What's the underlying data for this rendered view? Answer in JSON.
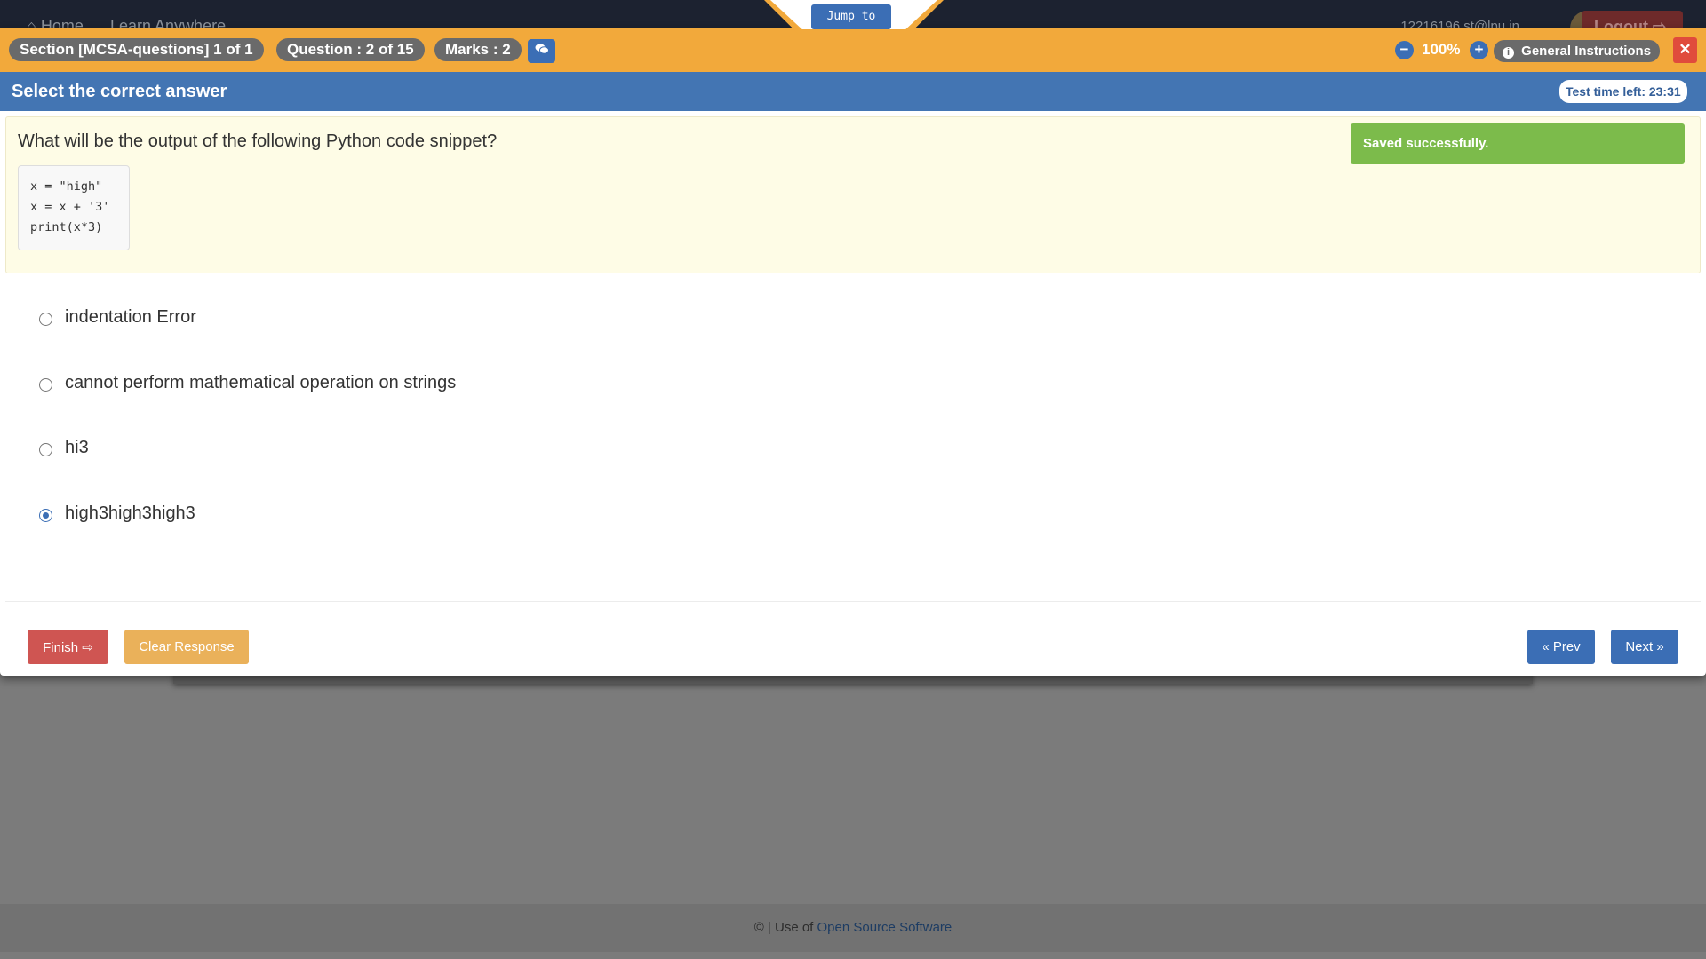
{
  "topnav": {
    "home_label": "Home",
    "learn_label": "Learn Anywhere",
    "user_id": "12216196.st@lpu.in",
    "logout_label": "Logout"
  },
  "header": {
    "section_label": "Section [MCSA-questions] 1 of 1",
    "question_label": "Question : 2 of 15",
    "marks_label": "Marks : 2",
    "zoom_level": "100%",
    "zoom_out_symbol": "−",
    "zoom_in_symbol": "+",
    "instructions_label": "General Instructions",
    "close_symbol": "✕",
    "jump_label": "Jump to"
  },
  "subheader": {
    "title": "Select the correct answer",
    "timer_label": "Test time left: 23:31"
  },
  "question": {
    "text": "What will be the output of the following Python code snippet?",
    "code_lines": [
      "x = \"high\"",
      "x = x + '3'",
      "print(x*3)"
    ]
  },
  "notification": {
    "text": "Saved successfully."
  },
  "options": [
    {
      "label": "indentation Error",
      "selected": false
    },
    {
      "label": "cannot perform mathematical operation on strings",
      "selected": false
    },
    {
      "label": "hi3",
      "selected": false
    },
    {
      "label": "high3high3high3",
      "selected": true
    }
  ],
  "actions": {
    "finish_label": "Finish",
    "clear_label": "Clear Response",
    "prev_label": "« Prev",
    "next_label": "Next »"
  },
  "footer": {
    "prefix": "© | Use of",
    "link_label": "Open Source Software"
  },
  "icons": {
    "chat": "chat-bubbles-icon",
    "info": "info-circle-icon",
    "logout": "sign-out-icon"
  },
  "colors": {
    "orange_bar": "#f2a93b",
    "blue_bar": "#4375b3",
    "success": "#7cbb4b",
    "danger": "#cf5552",
    "warning": "#eab15a",
    "primary": "#3b6eb5"
  }
}
